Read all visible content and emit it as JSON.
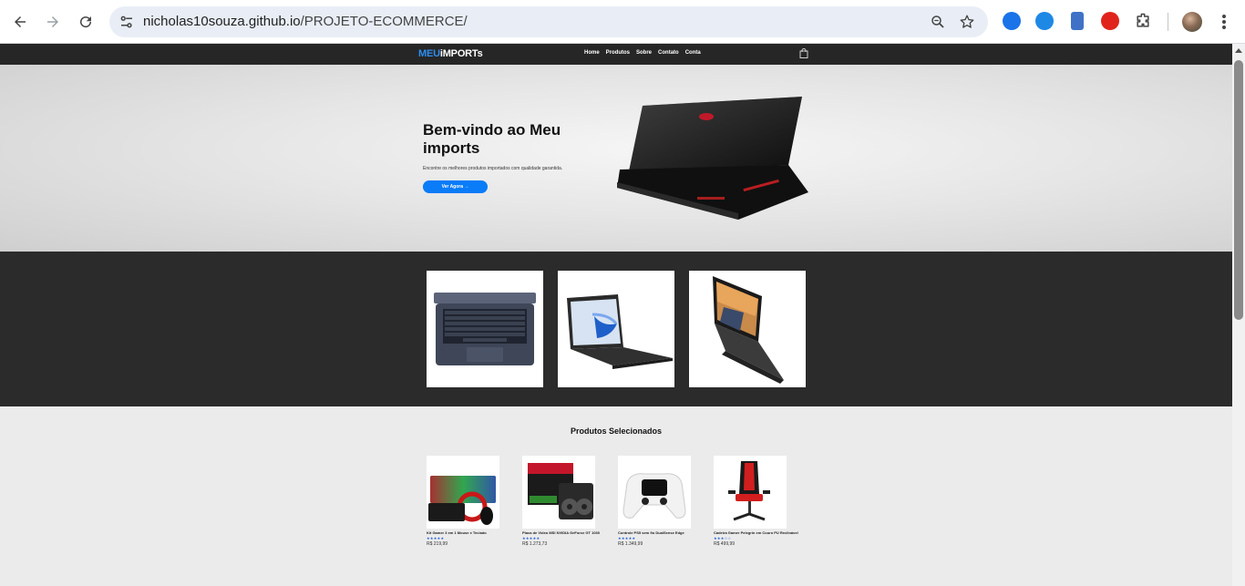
{
  "browser": {
    "url_host": "nicholas10souza.github.io",
    "url_path": "/PROJETO-ECOMMERCE/"
  },
  "site": {
    "logo_part1": "MEU",
    "logo_part2": "iMPORTs",
    "menu": [
      "Home",
      "Produtos",
      "Sobre",
      "Contato",
      "Conta"
    ],
    "accent": "#0a7cf7"
  },
  "hero": {
    "title": "Bem-vindo ao Meu imports",
    "subtitle": "Encontre os melhores produtos importados com qualidade garantida.",
    "cta": "Ver Agora →"
  },
  "products": {
    "heading": "Produtos Selecionados",
    "items": [
      {
        "name": "Kit Gamer 3 em 1 Mouse e Teclado",
        "stars": "★★★★★",
        "price": "R$ 219,99"
      },
      {
        "name": "Placa de Vídeo MSI NVIDIA GeForce GT 1030",
        "stars": "★★★★★",
        "price": "R$ 1.273,73"
      },
      {
        "name": "Controle PS5 sem fio DualSense Edge",
        "stars": "★★★★★",
        "price": "R$ 1.349,99"
      },
      {
        "name": "Cadeira Gamer Pelegrin em Couro PU Reclinável",
        "stars": "★★★☆☆",
        "price": "R$ 499,99"
      }
    ]
  }
}
